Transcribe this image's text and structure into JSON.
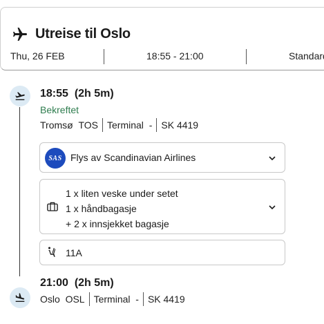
{
  "header": {
    "title": "Utreise til Oslo",
    "date": "Thu, 26 FEB",
    "time_range": "18:55 - 21:00",
    "fare_class": "Standard"
  },
  "departure": {
    "time": "18:55",
    "duration": "(2h 5m)",
    "status": "Bekreftet",
    "city": "Tromsø",
    "code": "TOS",
    "terminal": "Terminal  -",
    "flight": "SK 4419"
  },
  "airline": {
    "logo_text": "SAS",
    "label": "Flys av Scandinavian Airlines"
  },
  "baggage": {
    "lines": [
      "1 x liten veske under setet",
      "1 x håndbagasje",
      "+ 2 x innsjekket bagasje"
    ]
  },
  "seat": {
    "label": "11A"
  },
  "arrival": {
    "time": "21:00",
    "duration": "(2h 5m)",
    "city": "Oslo",
    "code": "OSL",
    "terminal": "Terminal  -",
    "flight": "SK 4419"
  },
  "colors": {
    "status_green": "#2f7d4f",
    "sas_blue": "#1d4bbd",
    "icon_circle": "#dceaf4"
  },
  "icons": {
    "title": "airplane-icon",
    "departure": "takeoff-icon",
    "arrival": "landing-icon",
    "baggage": "suitcase-icon",
    "seat": "seat-icon"
  }
}
